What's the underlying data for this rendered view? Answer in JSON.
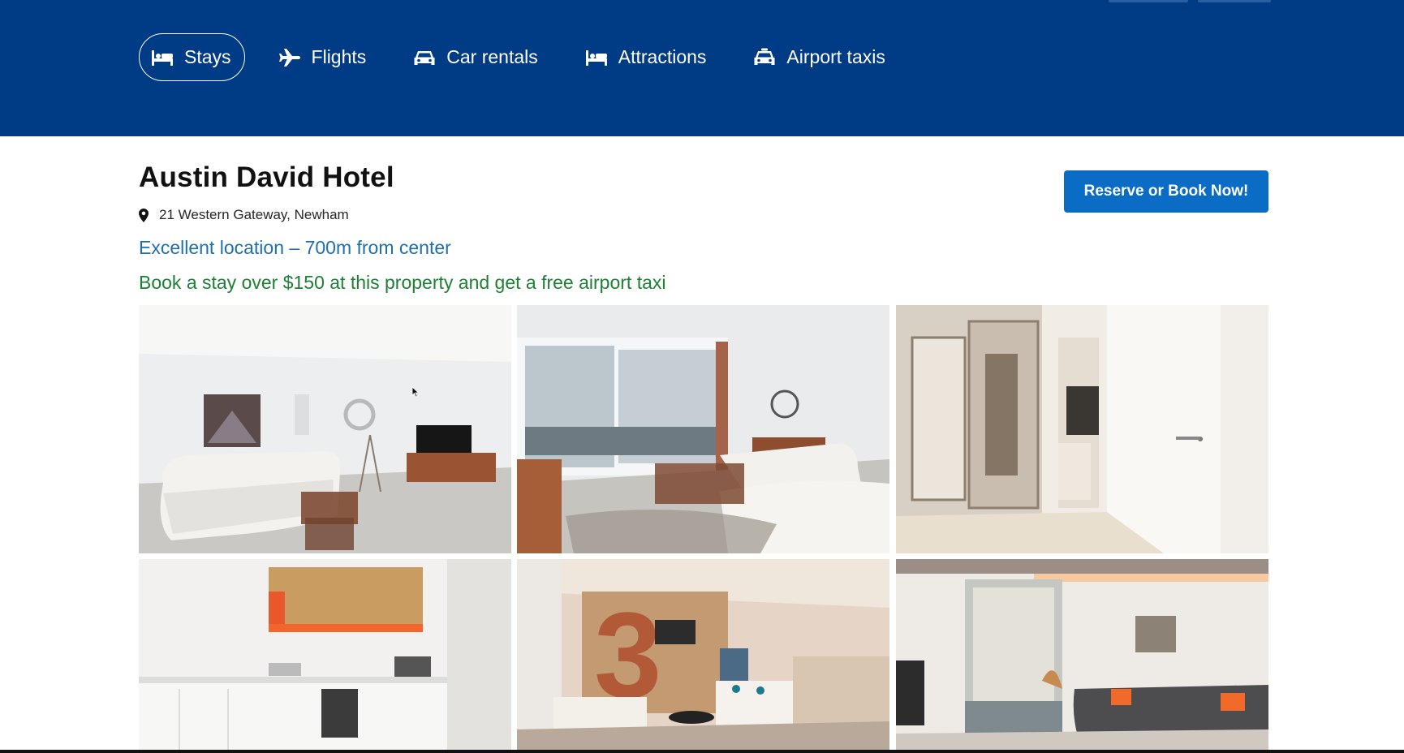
{
  "nav": {
    "items": [
      {
        "label": "Stays",
        "icon": "bed-icon",
        "active": true
      },
      {
        "label": "Flights",
        "icon": "plane-icon",
        "active": false
      },
      {
        "label": "Car rentals",
        "icon": "car-icon",
        "active": false
      },
      {
        "label": "Attractions",
        "icon": "bed-icon",
        "active": false
      },
      {
        "label": "Airport taxis",
        "icon": "taxi-icon",
        "active": false
      }
    ]
  },
  "hotel": {
    "name": "Austin David Hotel",
    "address": "21 Western Gateway, Newham",
    "location_note": "Excellent location – 700m from center",
    "promo": "Book a stay over $150 at this property and get a free airport taxi",
    "reserve_label": "Reserve or Book Now!"
  },
  "gallery": {
    "photos": [
      {
        "subject": "living-room-photo"
      },
      {
        "subject": "living-room-balcony-photo"
      },
      {
        "subject": "hallway-wardrobe-photo"
      },
      {
        "subject": "kitchen-photo"
      },
      {
        "subject": "lobby-lounge-photo"
      },
      {
        "subject": "lounge-window-photo"
      }
    ]
  },
  "colors": {
    "header": "#003b85",
    "location_text": "#1f6fae",
    "promo_text": "#1e7f35",
    "reserve_button": "#0a6cc4"
  }
}
